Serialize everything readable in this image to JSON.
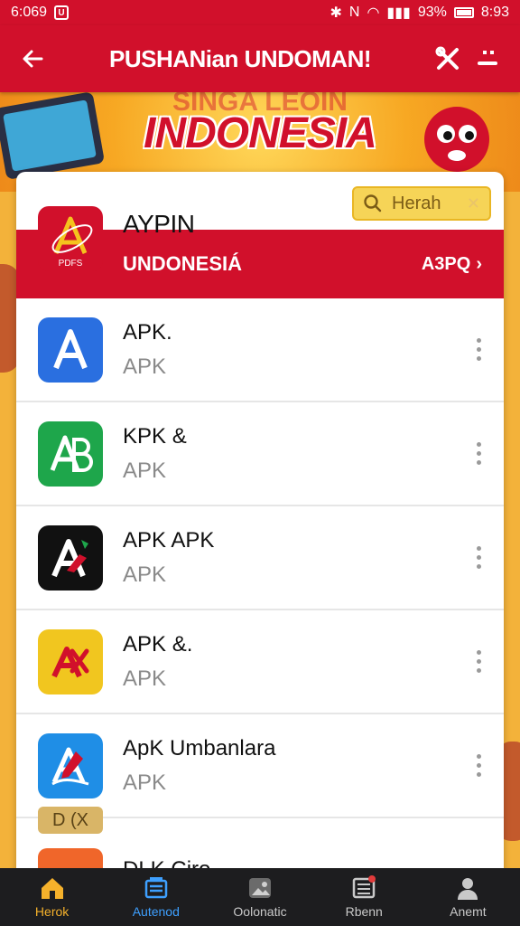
{
  "status_bar": {
    "time_left": "6:069",
    "badge": "U",
    "battery": "93%",
    "clock": "8:93"
  },
  "app_bar": {
    "title": "PUSHANian UNDOMAN!"
  },
  "banner": {
    "top_text": "SINGA LEOIN",
    "headline": "INDONESIA"
  },
  "card": {
    "app_name": "AYPIN",
    "icon_text": "PDFS",
    "search_placeholder": "Herah",
    "band_title": "UNDONESIÁ",
    "band_right": "A3PQ"
  },
  "list": [
    {
      "title": "APK.",
      "subtitle": "APK",
      "icon_color": "#2a6fe0",
      "icon_letter": "A"
    },
    {
      "title": "KPK &",
      "subtitle": "APK",
      "icon_color": "#1ea64b",
      "icon_letter": "AB"
    },
    {
      "title": "APK APK",
      "subtitle": "APK",
      "icon_color": "#111111",
      "icon_letter": "A"
    },
    {
      "title": "APK &.",
      "subtitle": "APK",
      "icon_color": "#f1c61f",
      "icon_letter": "A"
    },
    {
      "title": "ApK Umbanlara",
      "subtitle": "APK",
      "icon_color": "#1f8ee6",
      "icon_letter": "A"
    }
  ],
  "tag": "D (X",
  "partial_item": {
    "title": "DLK Ciro"
  },
  "nav": {
    "items": [
      {
        "label": "Herok",
        "icon": "home-icon"
      },
      {
        "label": "Autenod",
        "icon": "library-icon"
      },
      {
        "label": "Oolonatic",
        "icon": "gallery-icon"
      },
      {
        "label": "Rbenn",
        "icon": "list-icon"
      },
      {
        "label": "Anemt",
        "icon": "person-icon"
      }
    ]
  }
}
